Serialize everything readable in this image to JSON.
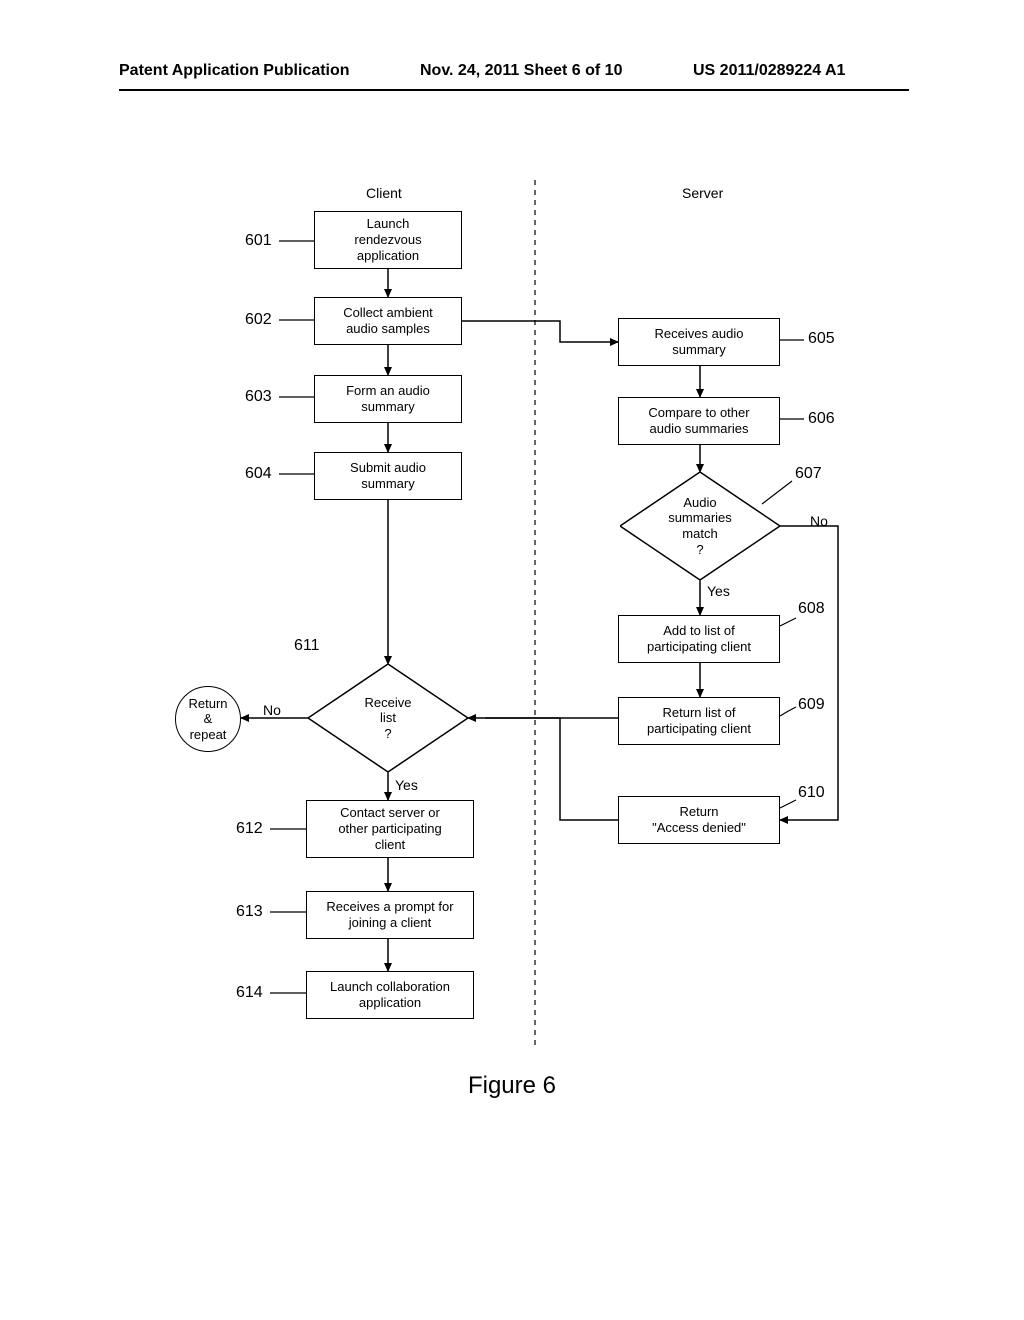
{
  "header": {
    "left": "Patent Application Publication",
    "center": "Nov. 24, 2011  Sheet 6 of 10",
    "right": "US 2011/0289224 A1"
  },
  "cols": {
    "client": "Client",
    "server": "Server"
  },
  "refs": {
    "r601": "601",
    "r602": "602",
    "r603": "603",
    "r604": "604",
    "r605": "605",
    "r606": "606",
    "r607": "607",
    "r608": "608",
    "r609": "609",
    "r610": "610",
    "r611": "611",
    "r612": "612",
    "r613": "613",
    "r614": "614"
  },
  "nodes": {
    "n601": "Launch\nrendezvous\napplication",
    "n602": "Collect ambient\naudio samples",
    "n603": "Form an audio\nsummary",
    "n604": "Submit audio\nsummary",
    "n605": "Receives audio\nsummary",
    "n606": "Compare to other\naudio summaries",
    "n607": "Audio\nsummaries\nmatch\n?",
    "n608": "Add to list of\nparticipating client",
    "n609": "Return list of\nparticipating client",
    "n610": "Return\n\"Access denied\"",
    "n611": "Receive\nlist\n?",
    "n611r": "Return\n&\nrepeat",
    "n612": "Contact server or\nother participating\nclient",
    "n613": "Receives a prompt for\njoining a client",
    "n614": "Launch collaboration\napplication"
  },
  "edges": {
    "yes": "Yes",
    "no": "No"
  },
  "caption": "Figure 6"
}
